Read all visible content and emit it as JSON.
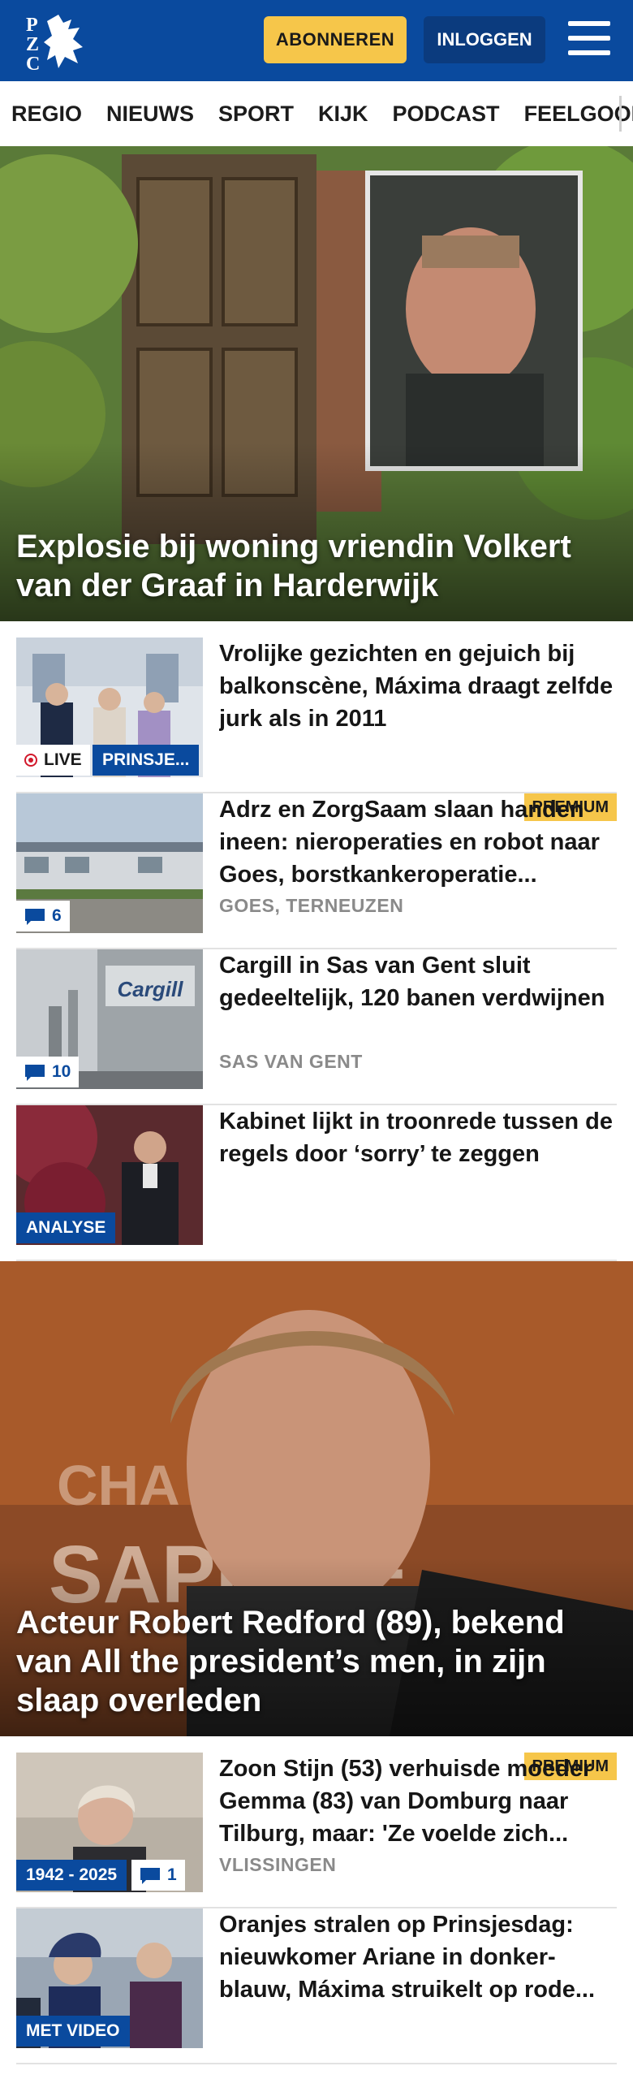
{
  "header": {
    "logo_text": "PZC",
    "subscribe_label": "ABONNEREN",
    "login_label": "INLOGGEN"
  },
  "nav": {
    "items": [
      "REGIO",
      "NIEUWS",
      "SPORT",
      "KIJK",
      "PODCAST",
      "FEELGOOD"
    ]
  },
  "hero1": {
    "title": "Explosie bij woning vriendin Volkert van der Graaf in Harderwijk"
  },
  "list1": [
    {
      "title": "Vrolijke gezichten en gejuich bij balkonscène, Máxima draagt zelfde jurk als in 2011",
      "live_label": "LIVE",
      "tag": "PRINSJE..."
    },
    {
      "title": "Adrz en ZorgSaam slaan handen ineen: nieroperaties en robot naar Goes, borstkankeroperatie...",
      "meta": "GOES, TERNEUZEN",
      "premium": "PREMIUM",
      "comments": "6"
    },
    {
      "title": "Cargill in Sas van Gent sluit gedeeltelijk, 120 banen verdwijnen",
      "meta": "SAS VAN GENT",
      "comments": "10",
      "sign_text": "Cargill"
    },
    {
      "title": "Kabinet lijkt in troonrede tussen de regels door ‘sorry’ te zeggen",
      "tag": "ANALYSE"
    }
  ],
  "hero2": {
    "title": "Acteur Robert Redford (89), bekend van All the president’s men, in zijn slaap overleden",
    "bg_text_top": "CHA",
    "bg_text_bottom": "SAPHIRE"
  },
  "list2": [
    {
      "title": "Zoon Stijn (53) verhuisde moeder Gemma (83) van Domburg naar Tilburg, maar: 'Ze voelde zich...",
      "meta": "VLISSINGEN",
      "premium": "PREMIUM",
      "tag": "1942 - 2025",
      "comments": "1"
    },
    {
      "title": "Oranjes stralen op Prinsjesdag: nieuwkomer Ariane in donker-blauw, Máxima struikelt op rode...",
      "tag": "MET VIDEO"
    }
  ],
  "colors": {
    "brand_blue": "#0a4a9e",
    "accent_yellow": "#f6c64a",
    "live_red": "#d2182b"
  }
}
